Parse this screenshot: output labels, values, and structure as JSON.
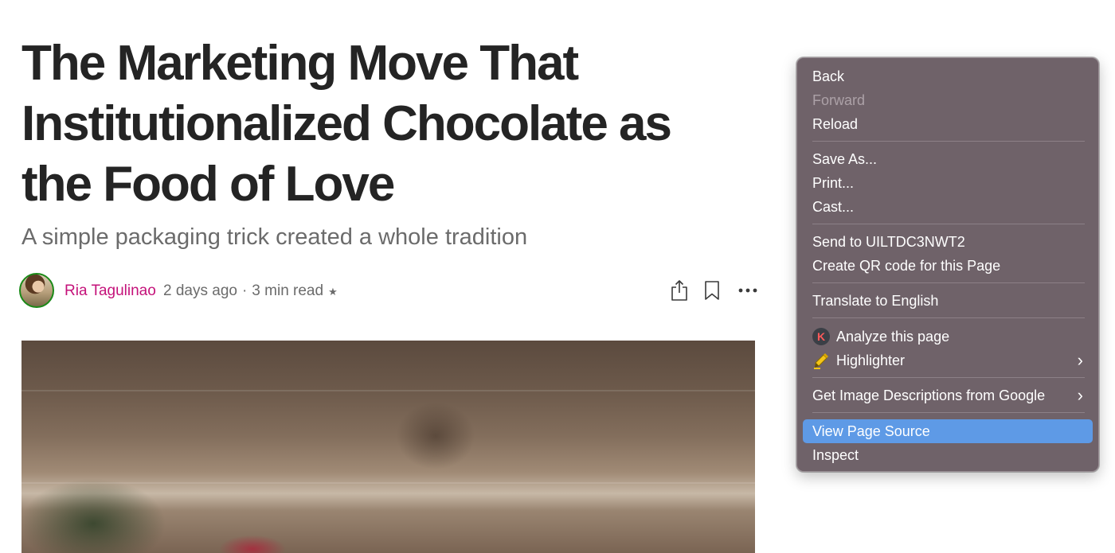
{
  "article": {
    "title": "The Marketing Move That Institutionalized Chocolate as the Food of Love",
    "subtitle": "A simple packaging trick created a whole tradition",
    "author": "Ria Tagulinao",
    "published": "2 days ago",
    "separator": "·",
    "read_time": "3 min read",
    "star": "★"
  },
  "icons": {
    "share": "share-icon",
    "bookmark": "bookmark-icon",
    "more": "more-icon",
    "analyze": "k-logo-icon",
    "highlighter": "highlighter-icon",
    "submenu": "chevron-right-icon"
  },
  "context_menu": {
    "back": "Back",
    "forward": "Forward",
    "reload": "Reload",
    "save_as": "Save As...",
    "print": "Print...",
    "cast": "Cast...",
    "send_to": "Send to UILTDC3NWT2",
    "qr_code": "Create QR code for this Page",
    "translate": "Translate to English",
    "analyze": "Analyze this page",
    "highlighter": "Highlighter",
    "image_descriptions": "Get Image Descriptions from Google",
    "view_source": "View Page Source",
    "inspect": "Inspect",
    "chevron": "›",
    "analyze_icon_letter": "K"
  },
  "colors": {
    "author": "#c4127a",
    "menu_background": "#6f6269",
    "menu_highlight": "#5e9ae6",
    "text_primary": "#242424",
    "text_secondary": "#6b6b6b"
  }
}
